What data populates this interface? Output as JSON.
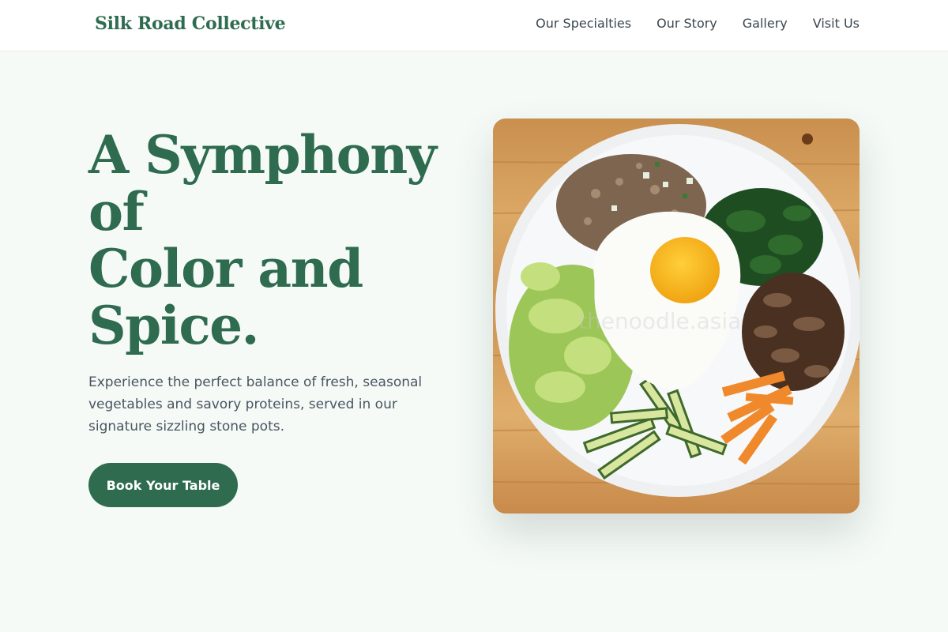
{
  "header": {
    "brand": "Silk Road Collective",
    "nav": [
      "Our Specialties",
      "Our Story",
      "Gallery",
      "Visit Us"
    ]
  },
  "hero": {
    "title_lines": [
      "A Symphony",
      "of",
      "Color and",
      "Spice."
    ],
    "description": "Experience the perfect balance of fresh, seasonal vegetables and savory proteins, served in our signature sizzling stone pots.",
    "cta_label": "Book Your Table"
  },
  "photo": {
    "subject": "bibimbap-bowl",
    "watermark": "thenoodle.asia"
  },
  "colors": {
    "brand_green": "#2e6b4f",
    "page_bg": "#f5faf7",
    "body_text": "#4a5560"
  }
}
